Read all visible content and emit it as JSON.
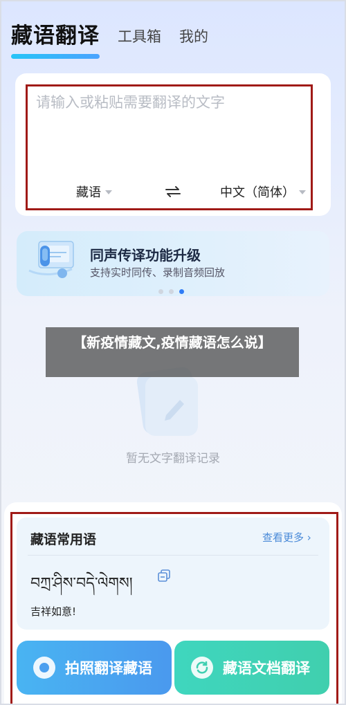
{
  "header": {
    "tabs": [
      {
        "label": "藏语翻译",
        "active": true
      },
      {
        "label": "工具箱",
        "active": false
      },
      {
        "label": "我的",
        "active": false
      }
    ]
  },
  "translator": {
    "placeholder": "请输入或粘贴需要翻译的文字",
    "source_lang": "藏语",
    "target_lang": "中文（简体）"
  },
  "banner": {
    "title": "同声传译功能升级",
    "subtitle": "支持实时同传、录制音频回放",
    "slide_count": 3,
    "active_slide": 3
  },
  "overlay": {
    "caption": "【新疫情藏文,疫情藏语怎么说】"
  },
  "history": {
    "empty_text": "暂无文字翻译记录"
  },
  "phrases": {
    "title": "藏语常用语",
    "more_label": "查看更多",
    "tibetan": "བཀྲ་ཤིས་བདེ་ལེགས།",
    "meaning": "吉祥如意!"
  },
  "actions": {
    "photo_label": "拍照翻译藏语",
    "doc_label": "藏语文档翻译"
  },
  "colors": {
    "accent": "#2f7cf6",
    "highlight_border": "#a01a17",
    "photo_button": "#49b4f2",
    "doc_button": "#3fd6be"
  }
}
